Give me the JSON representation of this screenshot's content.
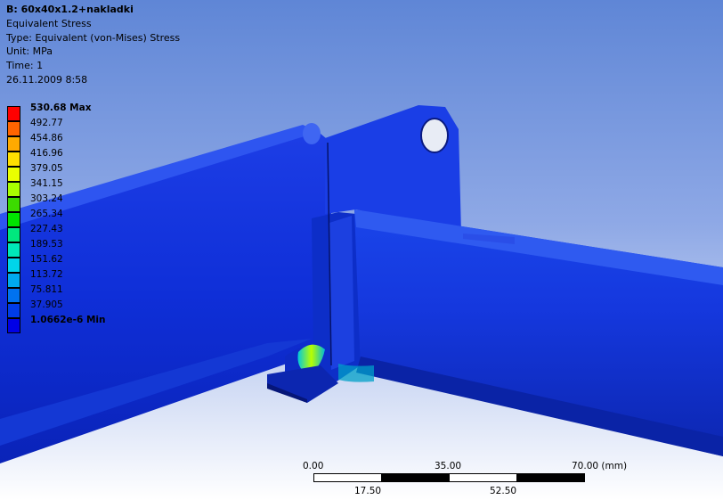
{
  "header": {
    "title": "B: 60x40x1.2+nakladki",
    "result_type": "Equivalent Stress",
    "type_line": "Type: Equivalent (von-Mises) Stress",
    "unit_line": "Unit: MPa",
    "time_line": "Time: 1",
    "timestamp": "26.11.2009 8:58"
  },
  "legend": {
    "levels": [
      {
        "label": "530.68 Max",
        "color": "#ff0000"
      },
      {
        "label": "492.77",
        "color": "#ff6400"
      },
      {
        "label": "454.86",
        "color": "#ffaa00"
      },
      {
        "label": "416.96",
        "color": "#ffdf00"
      },
      {
        "label": "379.05",
        "color": "#eaff00"
      },
      {
        "label": "341.15",
        "color": "#a8ff00"
      },
      {
        "label": "303.24",
        "color": "#3cdb00"
      },
      {
        "label": "265.34",
        "color": "#00e400"
      },
      {
        "label": "227.43",
        "color": "#00e87e"
      },
      {
        "label": "189.53",
        "color": "#00e8b8"
      },
      {
        "label": "151.62",
        "color": "#00d5ea"
      },
      {
        "label": "113.72",
        "color": "#00aaee"
      },
      {
        "label": "75.811",
        "color": "#0072f0"
      },
      {
        "label": "37.905",
        "color": "#003ce8"
      },
      {
        "label": "1.0662e-6 Min",
        "color": "#0000e6"
      }
    ]
  },
  "scale_bar": {
    "top_labels": [
      "0.00",
      "35.00",
      "70.00 (mm)"
    ],
    "bottom_labels": [
      "17.50",
      "52.50"
    ]
  },
  "colors": {
    "background_top": "#5f86d6",
    "background_bottom": "#ffffff",
    "model_blue": "#1a3be0",
    "model_dark": "#0a1c9a"
  }
}
